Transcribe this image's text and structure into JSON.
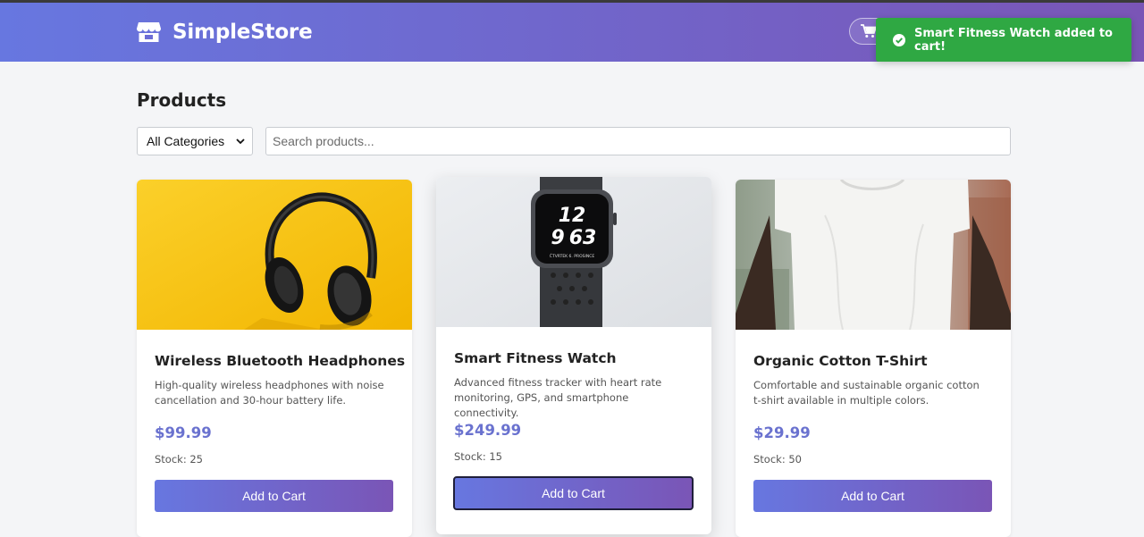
{
  "app": {
    "brand_name": "SimpleStore",
    "accent_gradient": [
      "#6777e0",
      "#7a55b6"
    ]
  },
  "toast": {
    "message": "Smart Fitness Watch added to cart!",
    "color": "#2fa843",
    "icon": "check-circle-icon"
  },
  "cart": {
    "icon": "shopping-cart-icon"
  },
  "page": {
    "title": "Products"
  },
  "filters": {
    "category_selected": "All Categories",
    "search_placeholder": "Search products..."
  },
  "products": [
    {
      "name": "Wireless Bluetooth Headphones",
      "description": "High-quality wireless headphones with noise cancellation and 30-hour battery life.",
      "price": "$99.99",
      "stock": "Stock: 25",
      "button": "Add to Cart",
      "image": "headphones-on-yellow"
    },
    {
      "name": "Smart Fitness Watch",
      "description": "Advanced fitness tracker with heart rate monitoring, GPS, and smartphone connectivity.",
      "price": "$249.99",
      "stock": "Stock: 15",
      "button": "Add to Cart",
      "image": "smart-watch",
      "watch_face": {
        "hour": "12",
        "digits_left": "9",
        "digits_right": "63",
        "footer": "ČTVRTEK 6. PROSINCE"
      }
    },
    {
      "name": "Organic Cotton T-Shirt",
      "description": "Comfortable and sustainable organic cotton t-shirt available in multiple colors.",
      "price": "$29.99",
      "stock": "Stock: 50",
      "button": "Add to Cart",
      "image": "white-tshirt"
    }
  ]
}
